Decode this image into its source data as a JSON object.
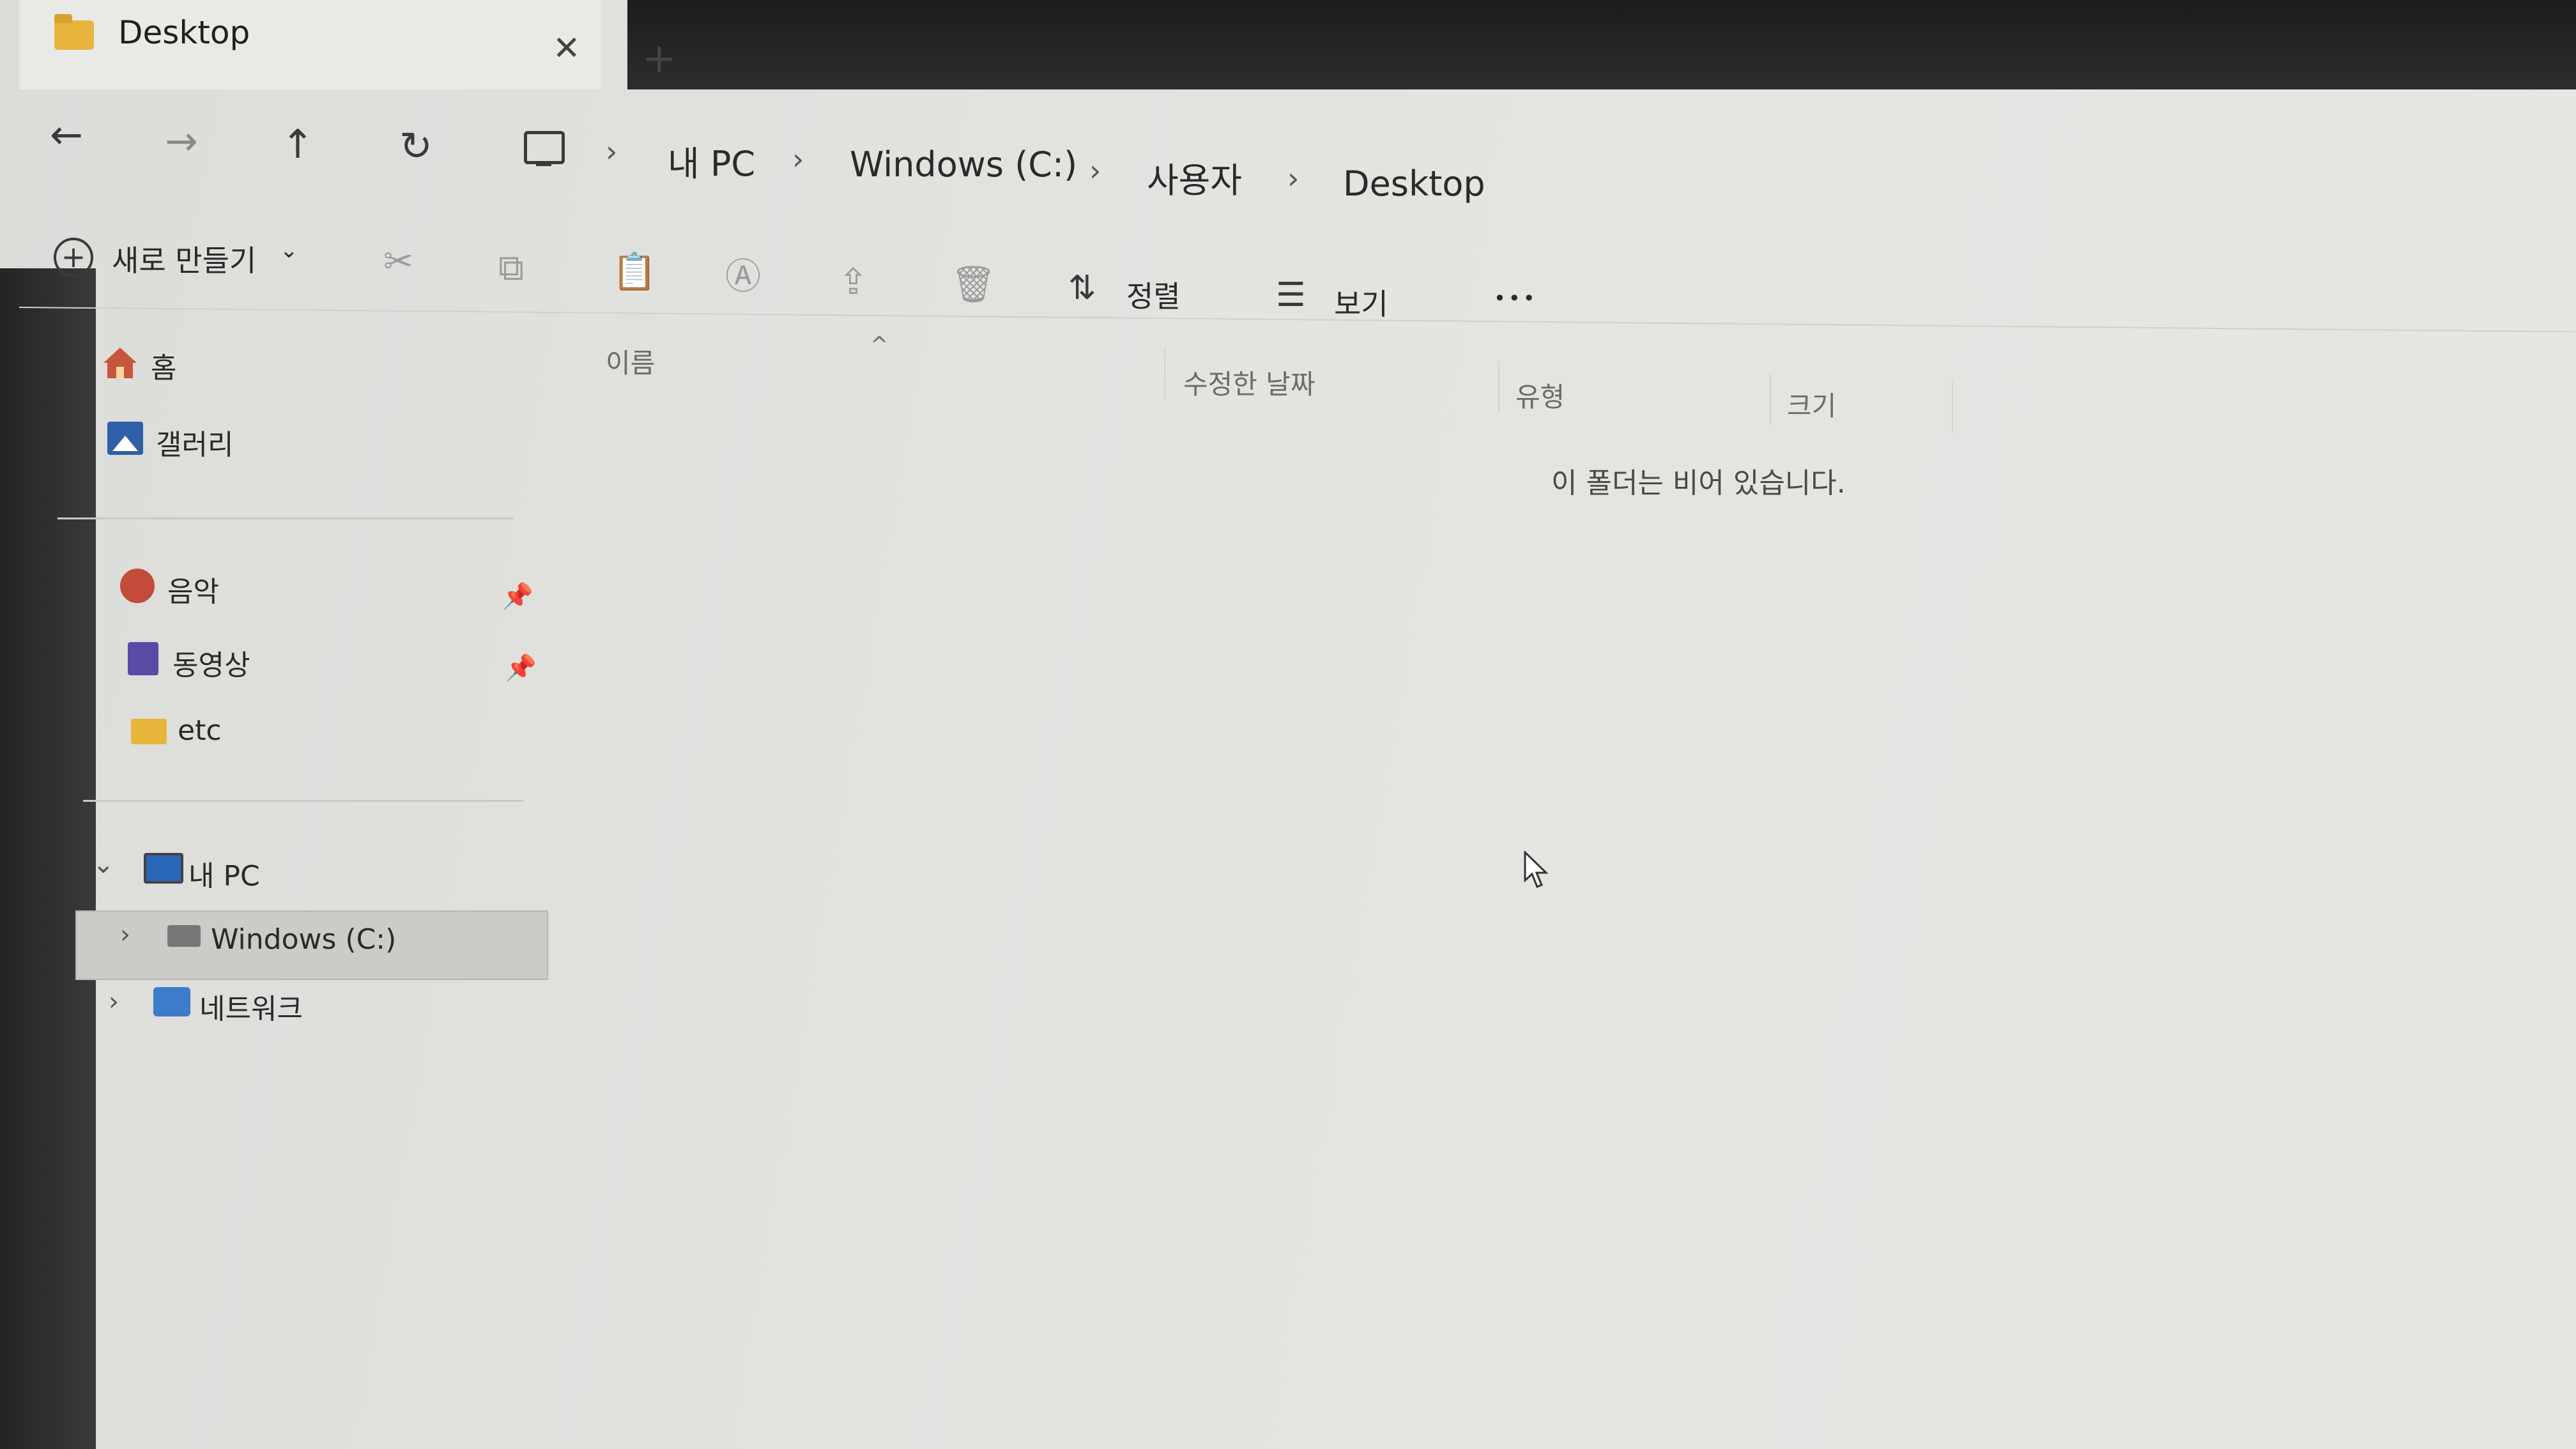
{
  "tab": {
    "title": "Desktop",
    "close": "✕",
    "new": "+"
  },
  "nav": {
    "back": "←",
    "forward": "→",
    "up": "↑",
    "refresh": "↻",
    "breadcrumb": [
      "내 PC",
      "Windows (C:)",
      "사용자",
      "Desktop"
    ],
    "separator": "›"
  },
  "toolbar": {
    "new_label": "새로 만들기",
    "new_chevron": "⌄",
    "sort_label": "정렬",
    "view_label": "보기",
    "more": "•••"
  },
  "sidebar": {
    "home": "홈",
    "gallery": "갤러리",
    "quick": [
      "음악",
      "동영상",
      "etc"
    ],
    "pc": "내 PC",
    "drive": "Windows (C:)",
    "network": "네트워크"
  },
  "columns": {
    "name": "이름",
    "modified": "수정한 날짜",
    "type": "유형",
    "size": "크기"
  },
  "empty_message": "이 폴더는 비어 있습니다."
}
